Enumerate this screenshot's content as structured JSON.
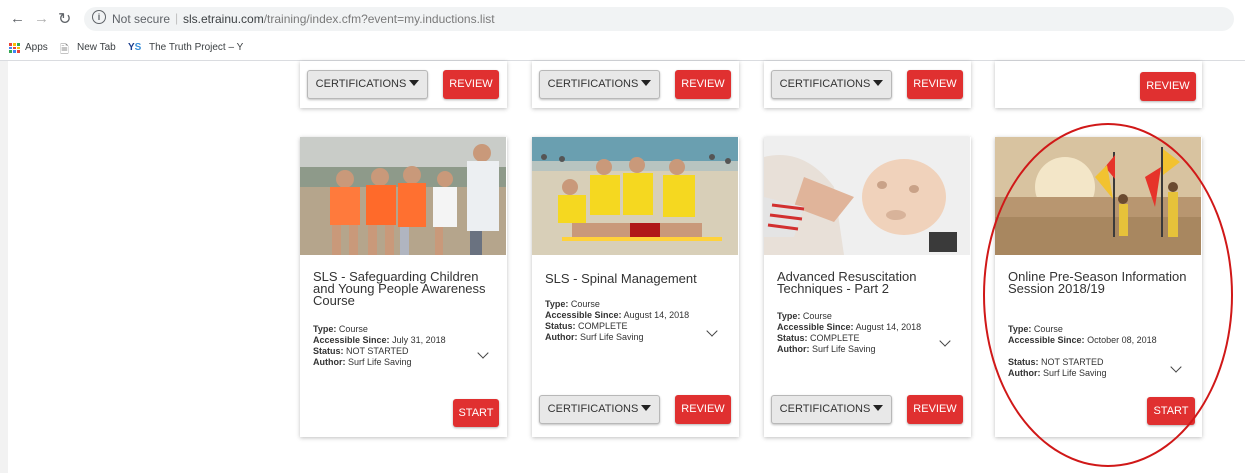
{
  "browser": {
    "not_secure": "Not secure",
    "separator": "|",
    "url_host": "sls.etrainu.com",
    "url_path": "/training/index.cfm?event=my.inductions.list"
  },
  "bookmarks": [
    {
      "label": "Apps"
    },
    {
      "label": "New Tab"
    },
    {
      "label": "The Truth Project – Y"
    }
  ],
  "buttons": {
    "certifications": "CERTIFICATIONS",
    "review": "REVIEW",
    "start": "START"
  },
  "meta_labels": {
    "type": "Type:",
    "accessible": "Accessible Since:",
    "status": "Status:",
    "author": "Author:"
  },
  "courses": [
    {
      "title": "SLS - Safeguarding Children and Young People Awareness Course",
      "type": "Course",
      "accessible_since": "July 31, 2018",
      "status": "NOT STARTED",
      "author": "Surf Life Saving"
    },
    {
      "title": "SLS - Spinal Management",
      "type": "Course",
      "accessible_since": "August 14, 2018",
      "status": "COMPLETE",
      "author": "Surf Life Saving"
    },
    {
      "title": "Advanced Resuscitation Techniques - Part 2",
      "type": "Course",
      "accessible_since": "August 14, 2018",
      "status": "COMPLETE",
      "author": "Surf Life Saving"
    },
    {
      "title": "Online Pre-Season Information Session 2018/19",
      "type": "Course",
      "accessible_since": "October 08, 2018",
      "status": "NOT STARTED",
      "author": "Surf Life Saving"
    }
  ],
  "colors": {
    "accent_red": "#e03030",
    "annotation_red": "#d01818"
  }
}
